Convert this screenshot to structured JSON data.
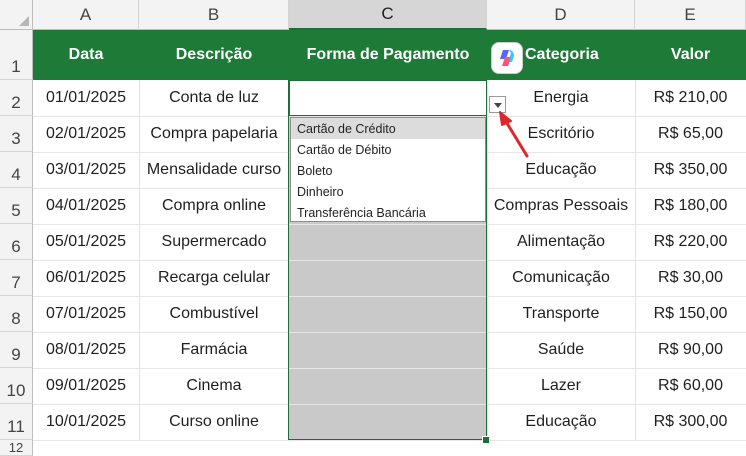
{
  "columns": [
    "A",
    "B",
    "C",
    "D",
    "E"
  ],
  "row_numbers": [
    "1",
    "2",
    "3",
    "4",
    "5",
    "6",
    "7",
    "8",
    "9",
    "10",
    "11",
    "12"
  ],
  "headers": {
    "data": "Data",
    "descricao": "Descrição",
    "forma": "Forma de Pagamento",
    "categoria": "Categoria",
    "valor": "Valor"
  },
  "rows": [
    {
      "data": "01/01/2025",
      "descricao": "Conta de luz",
      "categoria": "Energia",
      "valor": "R$ 210,00"
    },
    {
      "data": "02/01/2025",
      "descricao": "Compra papelaria",
      "categoria": "Escritório",
      "valor": "R$ 65,00"
    },
    {
      "data": "03/01/2025",
      "descricao": "Mensalidade curso",
      "categoria": "Educação",
      "valor": "R$ 350,00"
    },
    {
      "data": "04/01/2025",
      "descricao": "Compra online",
      "categoria": "Compras Pessoais",
      "valor": "R$ 180,00"
    },
    {
      "data": "05/01/2025",
      "descricao": "Supermercado",
      "categoria": "Alimentação",
      "valor": "R$ 220,00"
    },
    {
      "data": "06/01/2025",
      "descricao": "Recarga celular",
      "categoria": "Comunicação",
      "valor": "R$ 30,00"
    },
    {
      "data": "07/01/2025",
      "descricao": "Combustível",
      "categoria": "Transporte",
      "valor": "R$ 150,00"
    },
    {
      "data": "08/01/2025",
      "descricao": "Farmácia",
      "categoria": "Saúde",
      "valor": "R$ 90,00"
    },
    {
      "data": "09/01/2025",
      "descricao": "Cinema",
      "categoria": "Lazer",
      "valor": "R$ 60,00"
    },
    {
      "data": "10/01/2025",
      "descricao": "Curso online",
      "categoria": "Educação",
      "valor": "R$ 300,00"
    }
  ],
  "dropdown_options": [
    "Cartão de Crédito",
    "Cartão de Débito",
    "Boleto",
    "Dinheiro",
    "Transferência Bancária"
  ],
  "colors": {
    "header_green": "#1e7a37",
    "selection_border": "#1e6e3a",
    "arrow_red": "#e0262a"
  },
  "icons": [
    "copilot-icon",
    "dropdown-arrow-icon",
    "red-arrow-annotation"
  ]
}
